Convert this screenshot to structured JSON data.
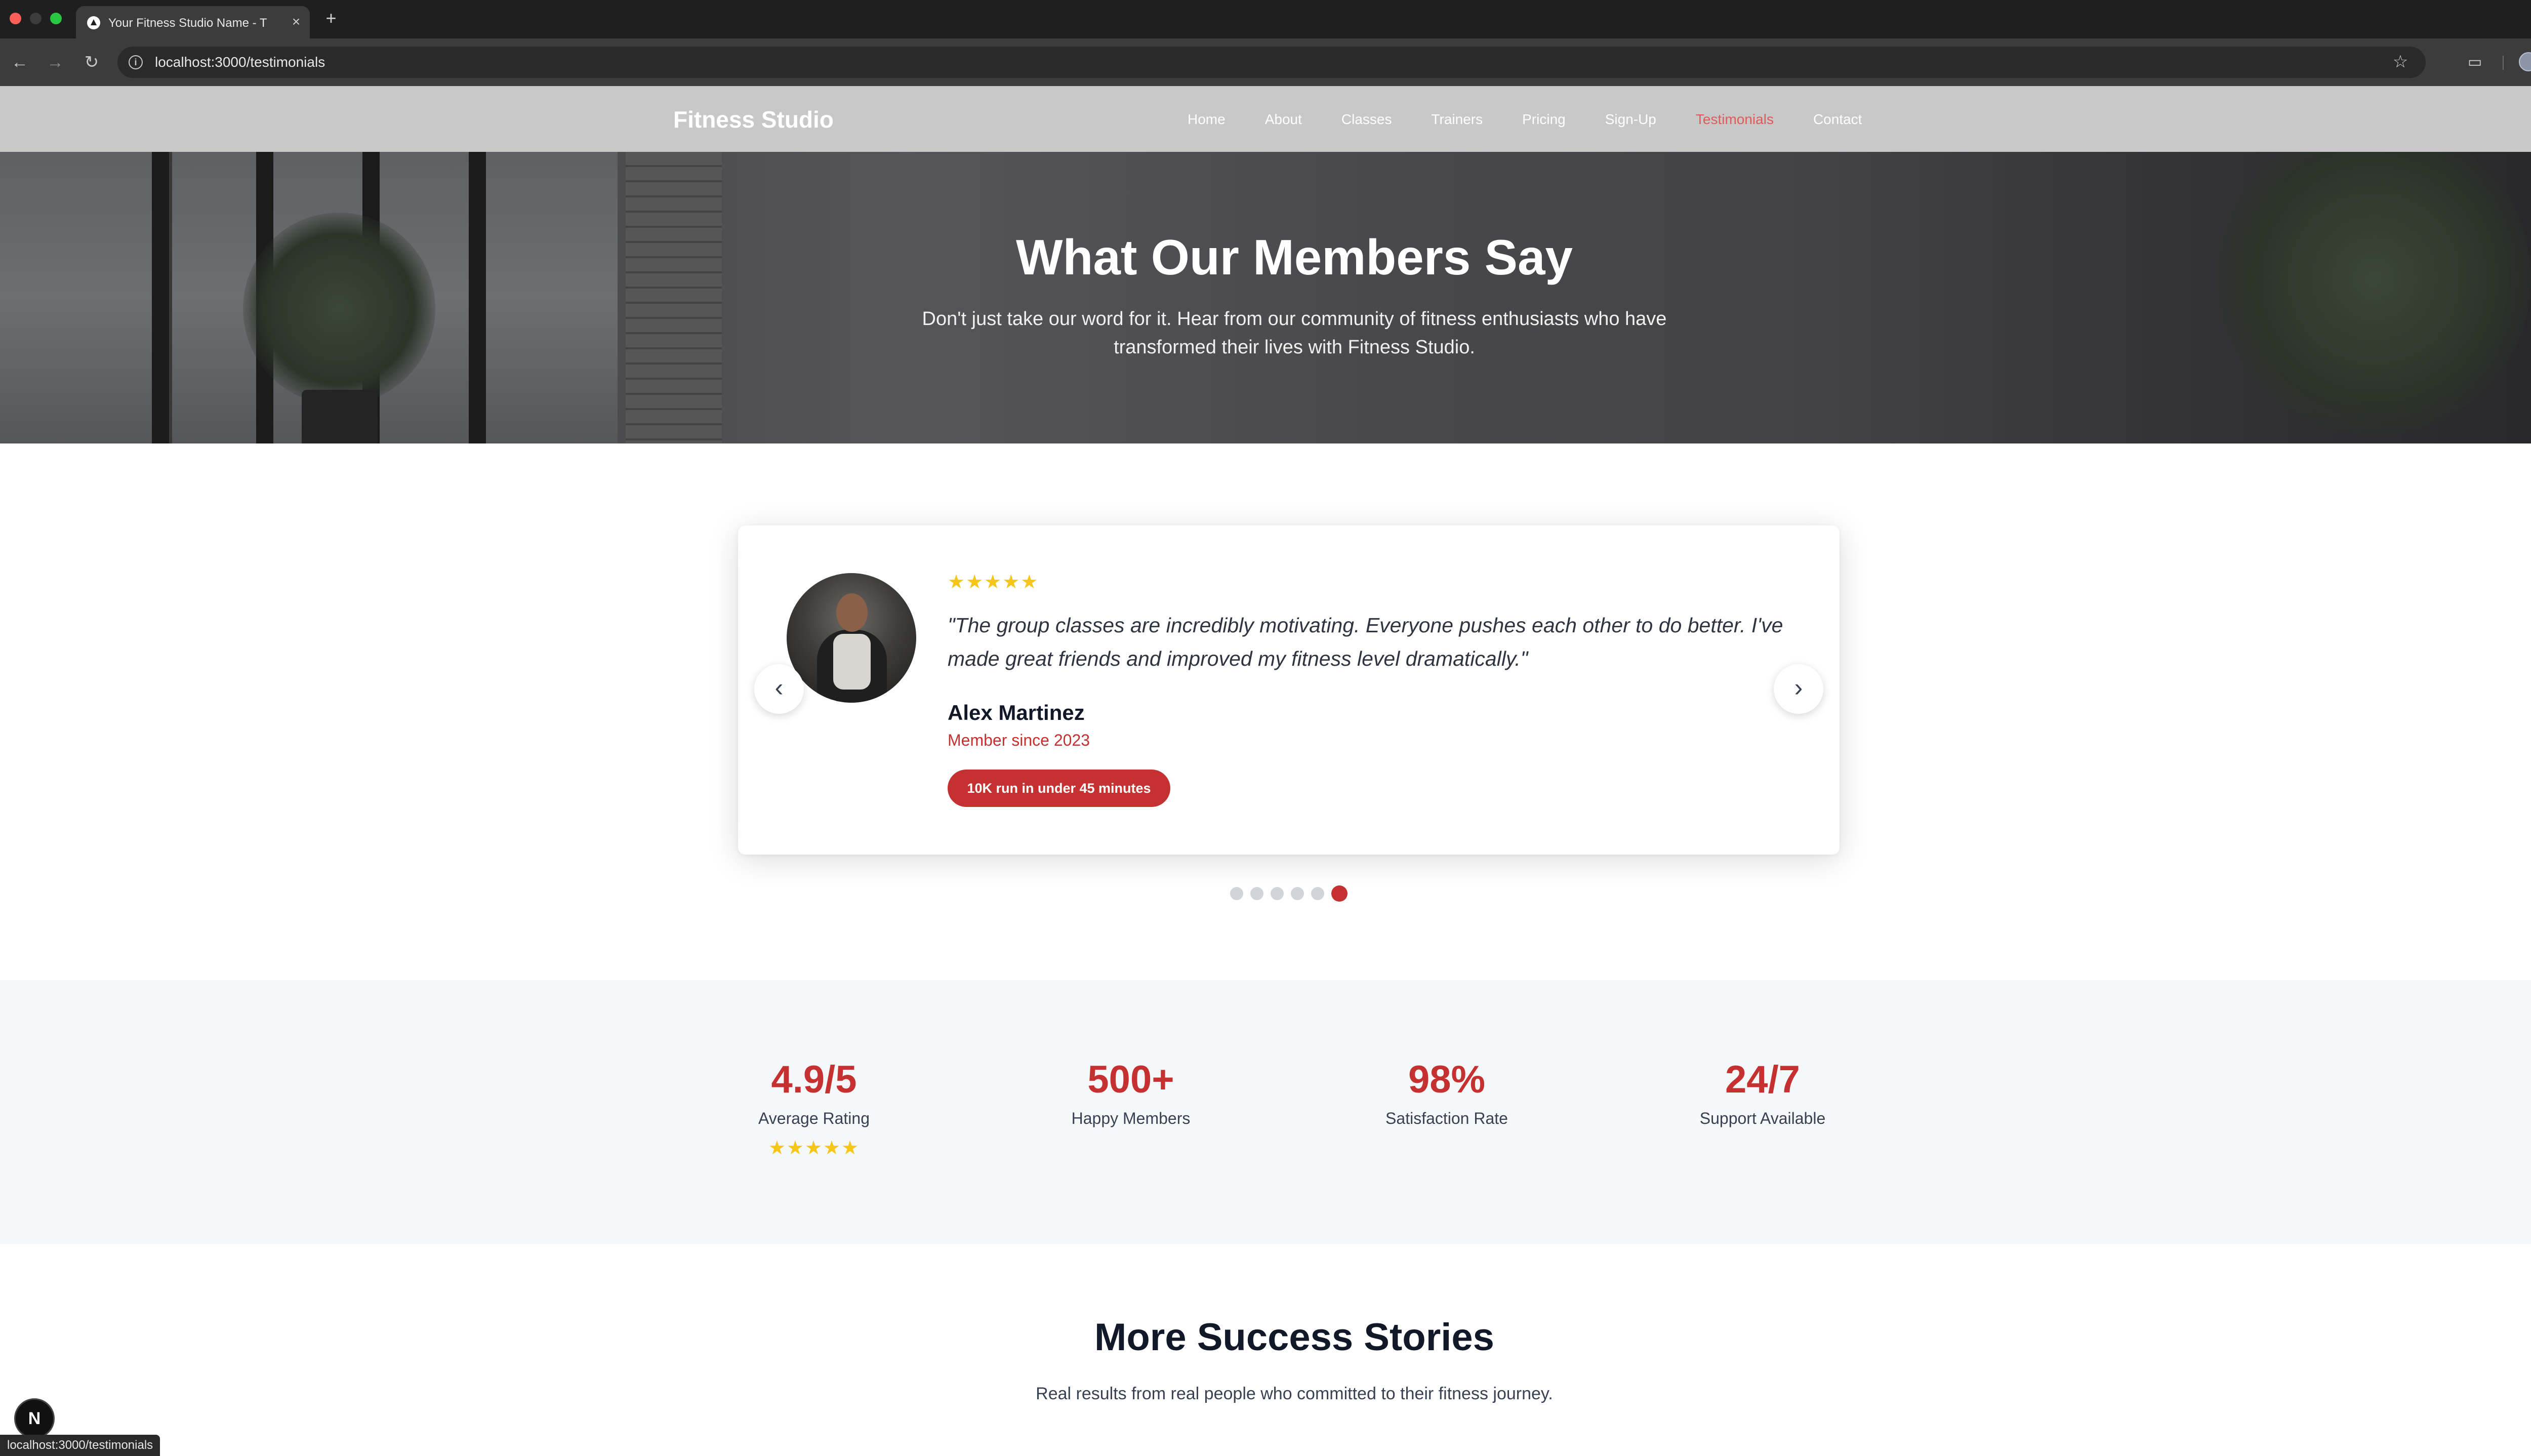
{
  "browser": {
    "tab_title": "Your Fitness Studio Name - T",
    "tab_close": "×",
    "new_tab": "+",
    "url": "localhost:3000/testimonials",
    "icons": [
      "back-arrow-icon",
      "forward-arrow-icon",
      "reload-icon",
      "site-info-icon",
      "bookmark-star-icon",
      "cast-icon",
      "profile-avatar",
      "more-vertical-icon"
    ]
  },
  "site_nav": {
    "brand": "Fitness Studio",
    "links": [
      "Home",
      "About",
      "Classes",
      "Trainers",
      "Pricing",
      "Sign-Up",
      "Testimonials",
      "Contact"
    ],
    "active_link": "Testimonials",
    "active_color": "#e05a5a"
  },
  "hero": {
    "title": "What Our Members Say",
    "subtitle": "Don't just take our word for it. Hear from our community of fitness enthusiasts who have transformed their lives with Fitness Studio."
  },
  "testimonial": {
    "stars": "★★★★★",
    "rating": 5,
    "quote": "\"The group classes are incredibly motivating. Everyone pushes each other to do better. I've made great friends and improved my fitness level dramatically.\"",
    "name": "Alex Martinez",
    "member_since": "Member since 2023",
    "achievement": "10K run in under 45 minutes",
    "prev_icon": "‹",
    "next_icon": "›",
    "slide_count": 6,
    "active_slide": 6
  },
  "stats": [
    {
      "value": "4.9/5",
      "label": "Average Rating",
      "stars": "★★★★★"
    },
    {
      "value": "500+",
      "label": "Happy Members"
    },
    {
      "value": "98%",
      "label": "Satisfaction Rate"
    },
    {
      "value": "24/7",
      "label": "Support Available"
    }
  ],
  "more_stories": {
    "title": "More Success Stories",
    "subtitle": "Real results from real people who committed to their fitness journey."
  },
  "overlay": {
    "next_badge": "N",
    "status_url": "localhost:3000/testimonials"
  },
  "colors": {
    "accent": "#c53030",
    "star": "#f5c518",
    "nav_bg": "#c8c8c8",
    "stats_bg": "#f6f7f9"
  }
}
